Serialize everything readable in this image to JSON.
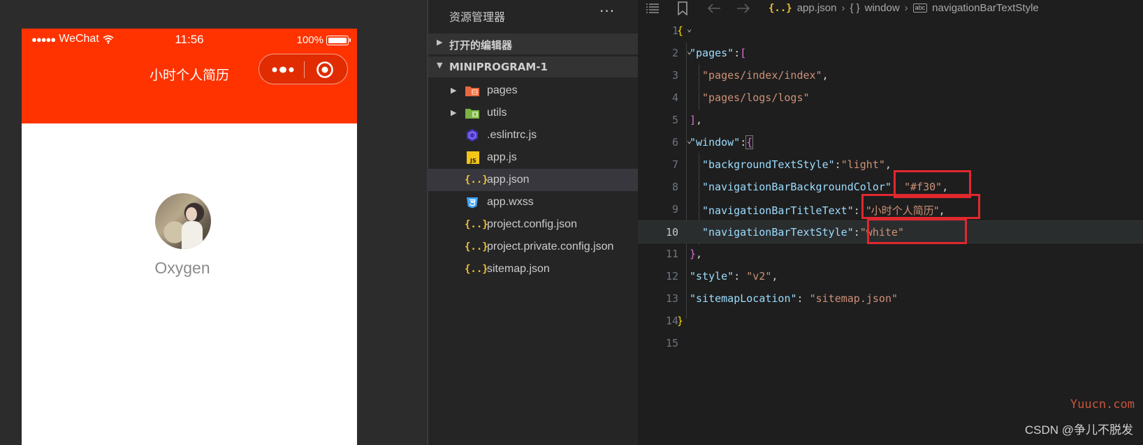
{
  "simulator": {
    "status_bar": {
      "carrier": "WeChat",
      "time": "11:56",
      "battery": "100%"
    },
    "nav_bar": {
      "title": "小时个人简历",
      "background_color": "#ff3300",
      "text_color": "#ffffff"
    },
    "page": {
      "nickname": "Oxygen"
    }
  },
  "explorer": {
    "title": "资源管理器",
    "more": "···",
    "sections": [
      {
        "label": "打开的编辑器",
        "expanded": false
      },
      {
        "label": "MINIPROGRAM-1",
        "expanded": true
      }
    ],
    "items": [
      {
        "label": "pages",
        "type": "folder",
        "icon": "folder-pages-icon"
      },
      {
        "label": "utils",
        "type": "folder",
        "icon": "folder-utils-icon"
      },
      {
        "label": ".eslintrc.js",
        "type": "file",
        "icon": "eslint-icon"
      },
      {
        "label": "app.js",
        "type": "file",
        "icon": "js-icon"
      },
      {
        "label": "app.json",
        "type": "file",
        "icon": "json-icon",
        "selected": true
      },
      {
        "label": "app.wxss",
        "type": "file",
        "icon": "css-icon"
      },
      {
        "label": "project.config.json",
        "type": "file",
        "icon": "json-icon"
      },
      {
        "label": "project.private.config.json",
        "type": "file",
        "icon": "json-icon"
      },
      {
        "label": "sitemap.json",
        "type": "file",
        "icon": "json-icon"
      }
    ],
    "json_glyph": "{..}"
  },
  "editor": {
    "breadcrumb": [
      "app.json",
      "window",
      "navigationBarTextStyle"
    ],
    "braces_glyph": "{ }",
    "abc_glyph": "abc",
    "lines": [
      {
        "n": "1"
      },
      {
        "n": "2",
        "key": "\"pages\"",
        "colon": ":",
        "open": "["
      },
      {
        "n": "3",
        "val": "\"pages/index/index\"",
        "comma": ","
      },
      {
        "n": "4",
        "val": "\"pages/logs/logs\""
      },
      {
        "n": "5",
        "close": "]",
        "comma": ","
      },
      {
        "n": "6",
        "key": "\"window\"",
        "colon": ":",
        "open": "{"
      },
      {
        "n": "7",
        "key": "\"backgroundTextStyle\"",
        "colon": ":",
        "val": "\"light\"",
        "comma": ","
      },
      {
        "n": "8",
        "key": "\"navigationBarBackgroundColor\"",
        "colon": ": ",
        "val": "\"#f30\"",
        "comma": ","
      },
      {
        "n": "9",
        "key": "\"navigationBarTitleText\"",
        "colon": ": ",
        "val": "\"小时个人简历\"",
        "comma": ","
      },
      {
        "n": "10",
        "key": "\"navigationBarTextStyle\"",
        "colon": ":",
        "val": "\"white\""
      },
      {
        "n": "11",
        "close": "}",
        "comma": ","
      },
      {
        "n": "12",
        "key": "\"style\"",
        "colon": ": ",
        "val": "\"v2\"",
        "comma": ","
      },
      {
        "n": "13",
        "key": "\"sitemapLocation\"",
        "colon": ": ",
        "val": "\"sitemap.json\""
      },
      {
        "n": "14"
      },
      {
        "n": "15"
      }
    ],
    "brace_open": "{",
    "brace_close": "}",
    "active_line": "10"
  },
  "watermarks": {
    "site": "Yuucn.com",
    "csdn": "CSDN @争儿不脱发"
  },
  "colors": {
    "accent": "#ff3300",
    "highlight_box": "#e0282f"
  }
}
